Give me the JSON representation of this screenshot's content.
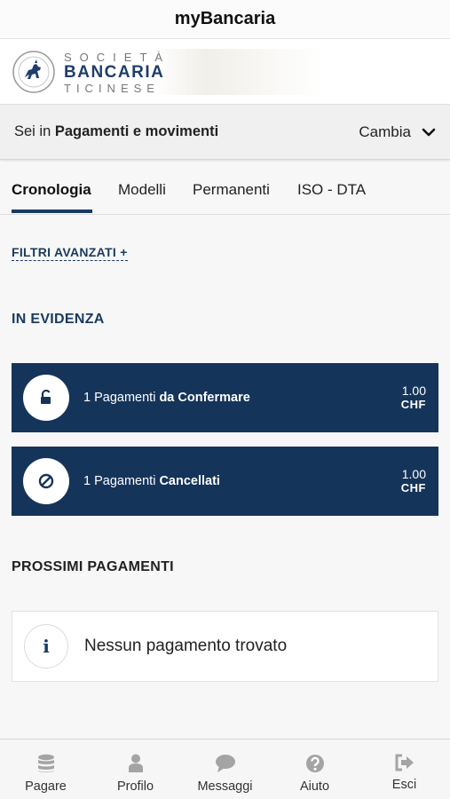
{
  "app": {
    "title": "myBancaria"
  },
  "brand": {
    "line1": "SOCIETÀ",
    "line2": "BANCARIA",
    "line3": "TICINESE"
  },
  "context": {
    "prefix": "Sei in",
    "section": "Pagamenti e movimenti",
    "change_label": "Cambia"
  },
  "tabs": [
    {
      "label": "Cronologia",
      "active": true
    },
    {
      "label": "Modelli",
      "active": false
    },
    {
      "label": "Permanenti",
      "active": false
    },
    {
      "label": "ISO - DTA",
      "active": false
    }
  ],
  "filters": {
    "label": "FILTRI AVANZATI +"
  },
  "highlight": {
    "title": "IN EVIDENZA",
    "cards": [
      {
        "icon": "unlock-icon",
        "count_text": "1 Pagamenti",
        "status": "da Confermare",
        "amount": "1.00",
        "currency": "CHF"
      },
      {
        "icon": "cancelled-icon",
        "count_text": "1 Pagamenti",
        "status": "Cancellati",
        "amount": "1.00",
        "currency": "CHF"
      }
    ]
  },
  "upcoming": {
    "title": "PROSSIMI PAGAMENTI",
    "empty_icon": "i",
    "empty_message": "Nessun pagamento trovato"
  },
  "bottom_nav": [
    {
      "label": "Pagare",
      "icon": "database-icon"
    },
    {
      "label": "Profilo",
      "icon": "user-icon"
    },
    {
      "label": "Messaggi",
      "icon": "chat-icon"
    },
    {
      "label": "Aiuto",
      "icon": "help-icon"
    },
    {
      "label": "Esci",
      "icon": "logout-icon"
    }
  ],
  "colors": {
    "primary": "#15345a",
    "nav_icon": "#a4a4a4"
  }
}
